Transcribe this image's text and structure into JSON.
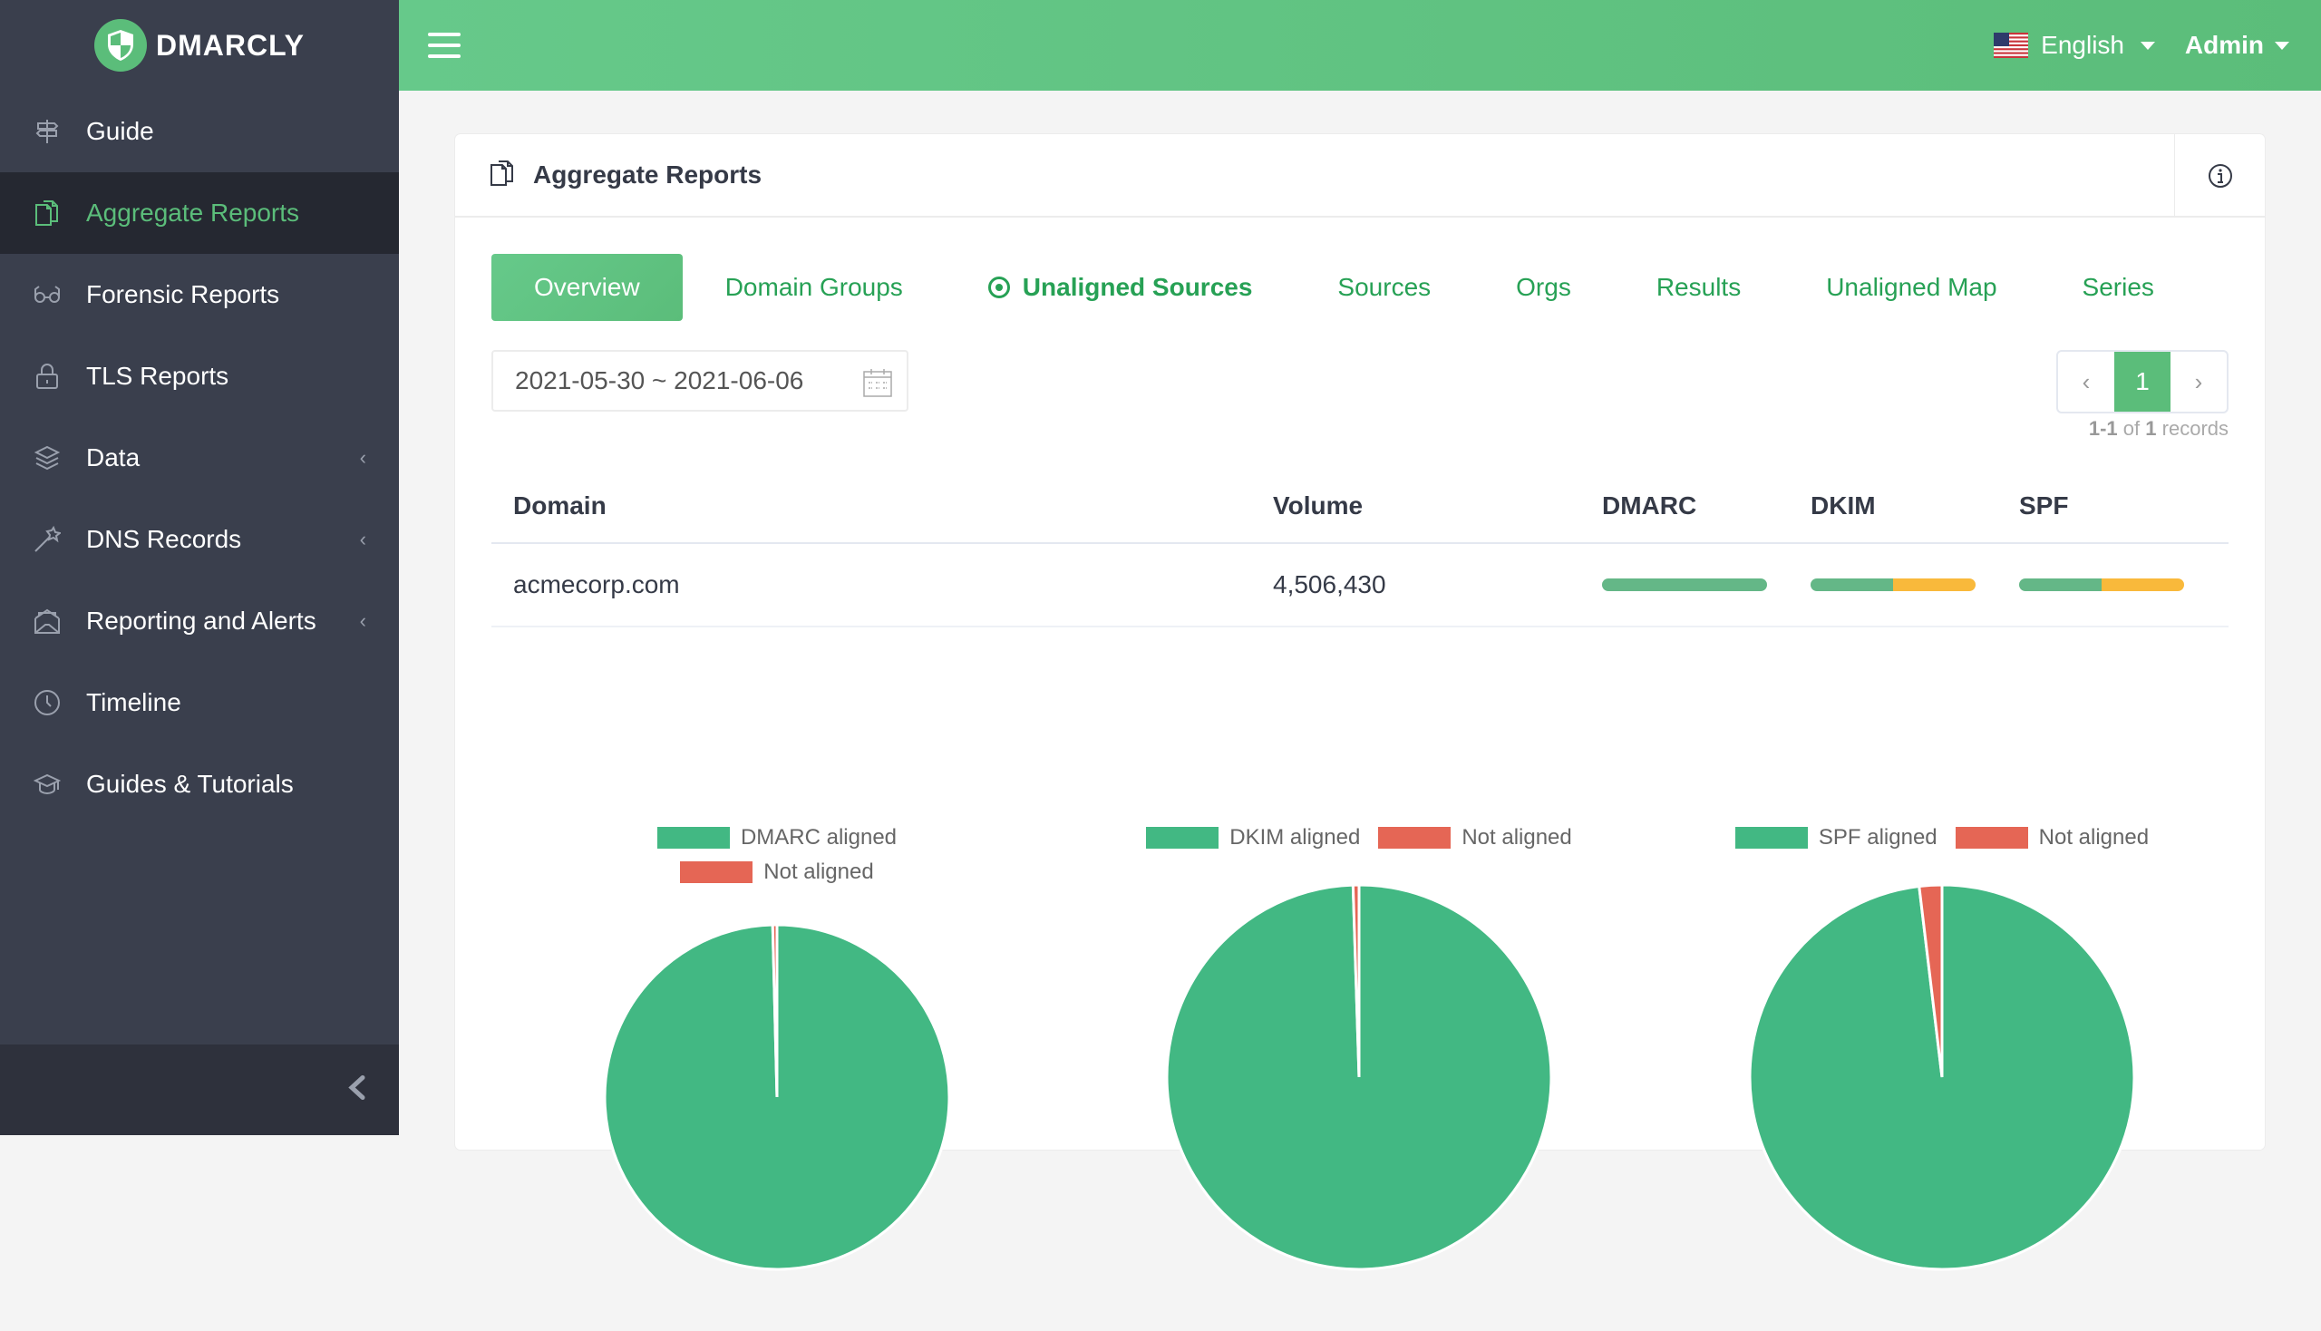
{
  "brand": {
    "name": "DMARCLY"
  },
  "sidebar": {
    "items": [
      {
        "label": "Guide",
        "icon": "signpost-icon",
        "active": false,
        "expandable": false
      },
      {
        "label": "Aggregate Reports",
        "icon": "documents-icon",
        "active": true,
        "expandable": false
      },
      {
        "label": "Forensic Reports",
        "icon": "glasses-icon",
        "active": false,
        "expandable": false
      },
      {
        "label": "TLS Reports",
        "icon": "lock-icon",
        "active": false,
        "expandable": false
      },
      {
        "label": "Data",
        "icon": "layers-icon",
        "active": false,
        "expandable": true
      },
      {
        "label": "DNS Records",
        "icon": "magic-wand-icon",
        "active": false,
        "expandable": true
      },
      {
        "label": "Reporting and Alerts",
        "icon": "envelope-open-icon",
        "active": false,
        "expandable": true
      },
      {
        "label": "Timeline",
        "icon": "clock-icon",
        "active": false,
        "expandable": false
      },
      {
        "label": "Guides & Tutorials",
        "icon": "graduation-cap-icon",
        "active": false,
        "expandable": false
      }
    ]
  },
  "topbar": {
    "language": "English",
    "user": "Admin"
  },
  "card": {
    "title": "Aggregate Reports"
  },
  "tabs": [
    {
      "label": "Overview",
      "style": "primary"
    },
    {
      "label": "Domain Groups",
      "style": "link"
    },
    {
      "label": "Unaligned Sources",
      "style": "selected"
    },
    {
      "label": "Sources",
      "style": "link"
    },
    {
      "label": "Orgs",
      "style": "link"
    },
    {
      "label": "Results",
      "style": "link"
    },
    {
      "label": "Unaligned Map",
      "style": "link"
    },
    {
      "label": "Series",
      "style": "link"
    }
  ],
  "date_range": "2021-05-30 ~ 2021-06-06",
  "pagination": {
    "prev": "‹",
    "current": "1",
    "next": "›",
    "range": "1-1",
    "of_label": "of",
    "total": "1",
    "records_label": "records"
  },
  "table": {
    "headers": [
      "Domain",
      "Volume",
      "DMARC",
      "DKIM",
      "SPF"
    ],
    "rows": [
      {
        "domain": "acmecorp.com",
        "volume": "4,506,430",
        "dmarc_bar": {
          "green": 1.0,
          "yellow": 0.0
        },
        "dkim_bar": {
          "green": 0.5,
          "yellow": 0.5
        },
        "spf_bar": {
          "green": 0.5,
          "yellow": 0.5
        }
      }
    ]
  },
  "colors": {
    "brand_green": "#5bbd7a",
    "link_green": "#27a155",
    "aligned": "#42b883",
    "not_aligned": "#e56655",
    "bar_green": "#64b787",
    "bar_yellow": "#f9b93b",
    "sidebar_bg": "#3a3f4d"
  },
  "chart_data": [
    {
      "type": "pie",
      "title": "",
      "legend": [
        "DMARC aligned",
        "Not aligned"
      ],
      "legend_position": "top",
      "values": [
        99.6,
        0.4
      ],
      "colors": [
        "#42b883",
        "#e56655"
      ]
    },
    {
      "type": "pie",
      "title": "",
      "legend": [
        "DKIM aligned",
        "Not aligned"
      ],
      "legend_position": "top",
      "values": [
        99.5,
        0.5
      ],
      "colors": [
        "#42b883",
        "#e56655"
      ]
    },
    {
      "type": "pie",
      "title": "",
      "legend": [
        "SPF aligned",
        "Not aligned"
      ],
      "legend_position": "top",
      "values": [
        98.1,
        1.9
      ],
      "colors": [
        "#42b883",
        "#e56655"
      ]
    }
  ]
}
